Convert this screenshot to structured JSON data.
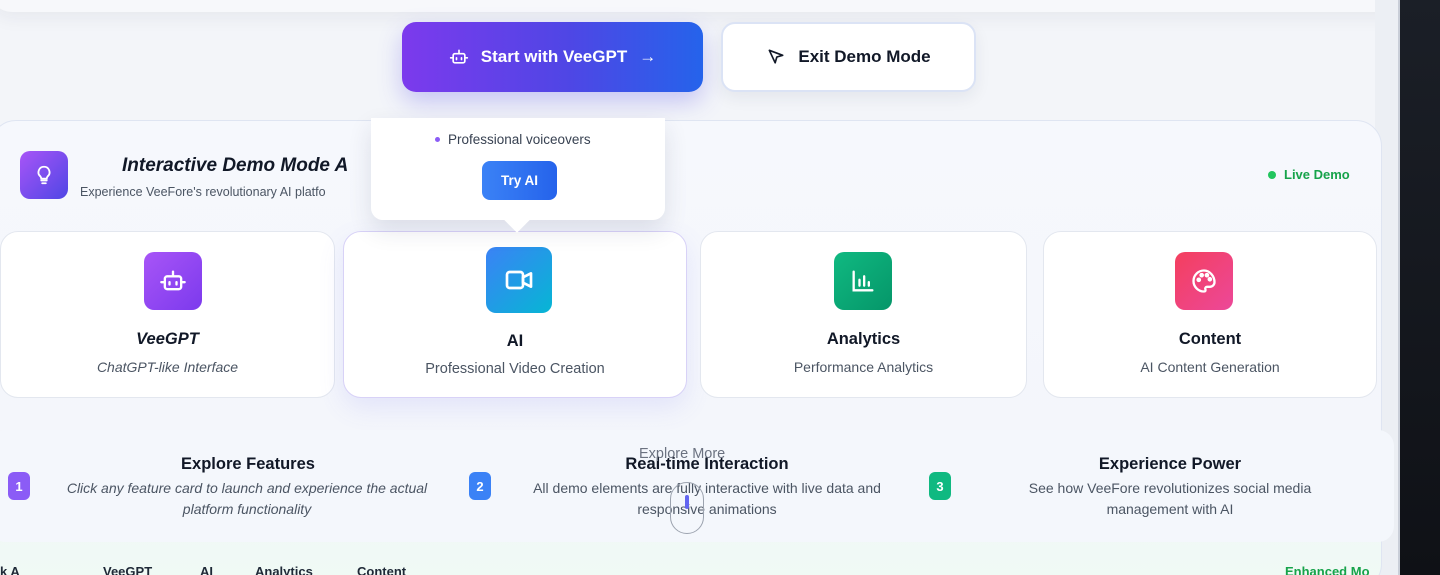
{
  "cta": {
    "primary_label": "Start with VeeGPT",
    "primary_arrow": "→",
    "secondary_label": "Exit Demo Mode"
  },
  "demo": {
    "title": "Interactive Demo Mode A",
    "subtitle": "Experience VeeFore's revolutionary AI platfo",
    "live_label": "Live Demo"
  },
  "tooltip": {
    "bullet": "Professional voiceovers",
    "button": "Try AI"
  },
  "features": [
    {
      "name": "VeeGPT",
      "desc": "ChatGPT-like Interface",
      "icon": "robot-icon",
      "color": "#8b5cf6"
    },
    {
      "name": "AI",
      "desc": "Professional Video Creation",
      "icon": "video-camera-icon",
      "color": "#3b82f6"
    },
    {
      "name": "Analytics",
      "desc": "Performance Analytics",
      "icon": "bar-chart-icon",
      "color": "#10b981"
    },
    {
      "name": "Content",
      "desc": "AI Content Generation",
      "icon": "palette-icon",
      "color": "#ec4899"
    }
  ],
  "steps": [
    {
      "num": "1",
      "title": "Explore Features",
      "desc": "Click any feature card to launch and experience the actual platform functionality",
      "color": "#8b5cf6"
    },
    {
      "num": "2",
      "title": "Real-time Interaction",
      "desc": "All demo elements are fully interactive with live data and responsive animations",
      "color": "#3b82f6"
    },
    {
      "num": "3",
      "title": "Experience Power",
      "desc": "See how VeeFore revolutionizes social media management with AI",
      "color": "#10b981"
    }
  ],
  "explore_more": "Explore More",
  "bottom_row": [
    "k A",
    "VeeGPT",
    "AI",
    "Analytics",
    "Content",
    "Enhanced Mo"
  ]
}
